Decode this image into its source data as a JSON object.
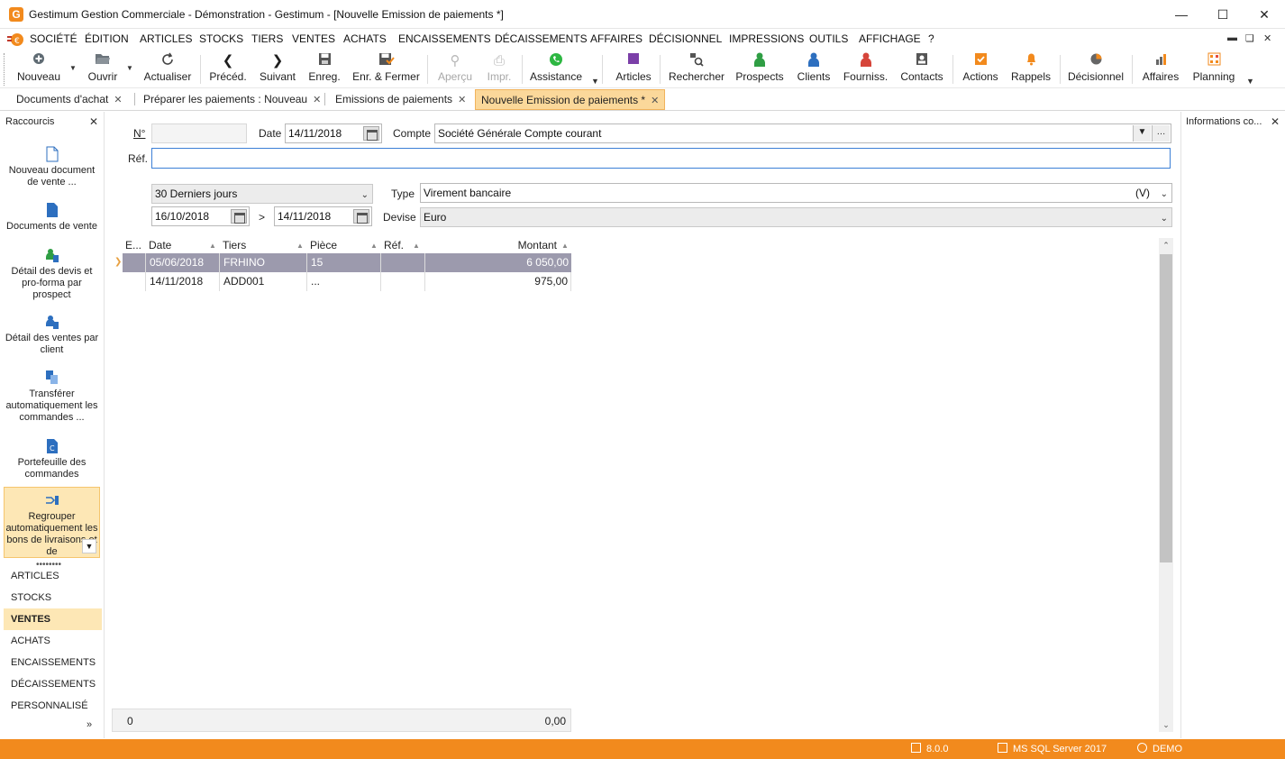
{
  "window": {
    "title": "Gestimum Gestion Commerciale - Démonstration - Gestimum - [Nouvelle Emission de paiements *]",
    "app_logo_letter": "G"
  },
  "menu": [
    "SOCIÉTÉ",
    "ÉDITION",
    "ARTICLES",
    "STOCKS",
    "TIERS",
    "VENTES",
    "ACHATS",
    "ENCAISSEMENTS",
    "DÉCAISSEMENTS",
    "AFFAIRES",
    "DÉCISIONNEL",
    "IMPRESSIONS",
    "OUTILS",
    "AFFICHAGE",
    "?"
  ],
  "toolbar": {
    "nouveau": "Nouveau",
    "ouvrir": "Ouvrir",
    "actualiser": "Actualiser",
    "preced": "Précéd.",
    "suivant": "Suivant",
    "enreg": "Enreg.",
    "enr_fermer": "Enr. & Fermer",
    "apercu": "Aperçu",
    "impr": "Impr.",
    "assistance": "Assistance",
    "articles": "Articles",
    "rechercher": "Rechercher",
    "prospects": "Prospects",
    "clients": "Clients",
    "fourniss": "Fourniss.",
    "contacts": "Contacts",
    "actions": "Actions",
    "rappels": "Rappels",
    "decisionnel": "Décisionnel",
    "affaires": "Affaires",
    "planning": "Planning"
  },
  "doc_tabs": [
    "Documents d'achat",
    "Préparer les paiements : Nouveau",
    "Emissions de paiements",
    "Nouvelle Emission de paiements *"
  ],
  "left_pane": {
    "title": "Raccourcis",
    "shortcuts": [
      "Nouveau document de vente ...",
      "Documents de vente",
      "Détail des devis et pro-forma par prospect",
      "Détail des ventes par client",
      "Transférer automatiquement les commandes ...",
      "Portefeuille des commandes",
      "Regrouper automatiquement les bons de livraisons et de"
    ],
    "nav": [
      "ARTICLES",
      "STOCKS",
      "VENTES",
      "ACHATS",
      "ENCAISSEMENTS",
      "DÉCAISSEMENTS",
      "PERSONNALISÉ"
    ]
  },
  "right_pane": {
    "title": "Informations co..."
  },
  "form": {
    "num_label": "N°",
    "num_value": "",
    "date_label": "Date",
    "date_value": "14/11/2018",
    "compte_label": "Compte",
    "compte_value": "Société Générale Compte courant",
    "ref_label": "Réf.",
    "ref_value": "",
    "period_value": "30 Derniers jours",
    "date_from": "16/10/2018",
    "range_sep": ">",
    "date_to": "14/11/2018",
    "type_label": "Type",
    "type_value": "Virement bancaire",
    "type_code": "(V)",
    "devise_label": "Devise",
    "devise_value": "Euro"
  },
  "grid": {
    "columns": [
      "E...",
      "Date",
      "Tiers",
      "Pièce",
      "Réf.",
      "Montant"
    ],
    "rows": [
      {
        "e": "",
        "date": "05/06/2018",
        "tiers": "FRHINO",
        "piece": "15",
        "ref": "",
        "montant": "6 050,00"
      },
      {
        "e": "",
        "date": "14/11/2018",
        "tiers": "ADD001",
        "piece": "...",
        "ref": "",
        "montant": "975,00"
      }
    ],
    "footer_count": "0",
    "footer_total": "0,00"
  },
  "status": {
    "version": "8.0.0",
    "database": "MS SQL Server 2017",
    "user": "DEMO"
  },
  "colors": {
    "accent": "#f28a1d",
    "tab_active": "#fbd89a",
    "selected_row": "#9c9aad"
  }
}
